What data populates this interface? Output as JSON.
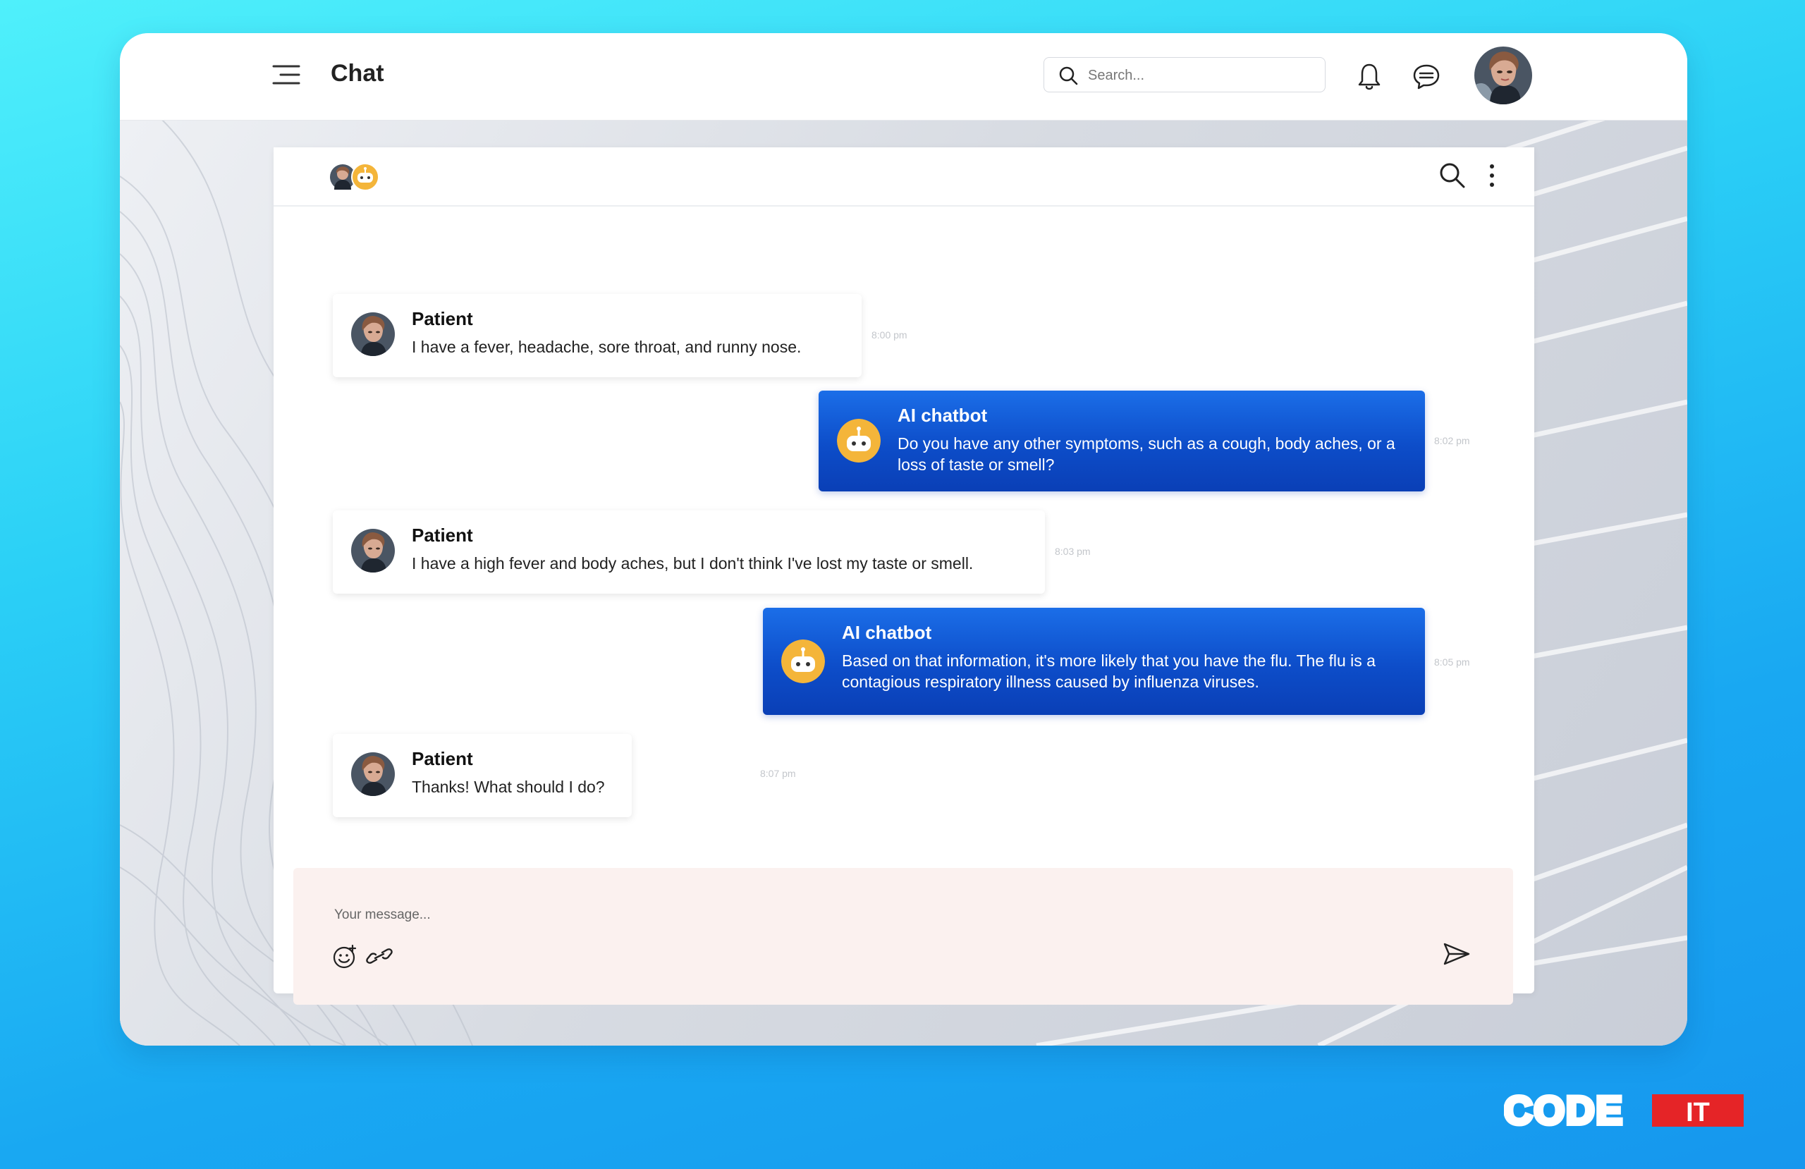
{
  "header": {
    "title": "Chat",
    "search_placeholder": "Search...",
    "icons": [
      "menu-icon",
      "search-icon",
      "bell-icon",
      "message-icon"
    ]
  },
  "chat": {
    "header_icons": [
      "search-icon",
      "more-vertical-icon"
    ],
    "messages": [
      {
        "sender": "Patient",
        "text": "I have a fever, headache, sore throat, and runny nose.",
        "time": "8:00 pm"
      },
      {
        "sender": "AI chatbot",
        "text": "Do you have any other symptoms, such as a cough, body aches, or a loss of taste or smell?",
        "time": "8:02 pm"
      },
      {
        "sender": "Patient",
        "text": "I have a high fever and body aches, but I don't think I've lost my taste or smell.",
        "time": "8:03 pm"
      },
      {
        "sender": "AI chatbot",
        "text": "Based on that information, it's more likely that you have the flu. The flu is a contagious respiratory illness caused by influenza viruses.",
        "time": "8:05 pm"
      },
      {
        "sender": "Patient",
        "text": "Thanks! What should I do?",
        "time": "8:07 pm"
      }
    ]
  },
  "composer": {
    "placeholder": "Your message...",
    "icons": [
      "emoji-icon",
      "link-icon",
      "send-icon"
    ]
  },
  "brand": {
    "part1": "CODE",
    "part2": "IT"
  },
  "colors": {
    "accent_blue": "#0d4dc9",
    "brand_red": "#e52427",
    "composer_bg": "#fbf1ef"
  }
}
